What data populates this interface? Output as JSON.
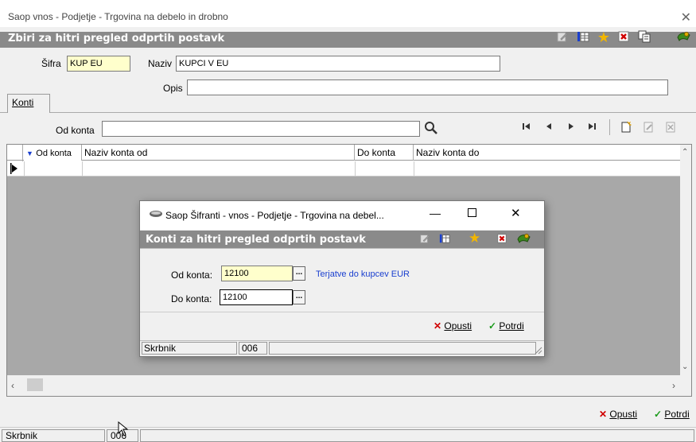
{
  "window": {
    "title": "Saop vnos - Podjetje - Trgovina na debelo in drobno",
    "close_glyph": "✕"
  },
  "header": {
    "title": "Zbiri za hitri pregled odprtih postavk",
    "toolbar_icons": [
      "edit-icon",
      "grid-icon",
      "star-icon",
      "delete-icon",
      "copy-icon",
      "exit-icon"
    ]
  },
  "form": {
    "sifra_label": "Šifra",
    "sifra_value": "KUP EU",
    "naziv_label": "Naziv",
    "naziv_value": "KUPCI V EU",
    "opis_label": "Opis",
    "opis_value": ""
  },
  "tabs": [
    {
      "label": "Konti"
    }
  ],
  "filter": {
    "label": "Od konta",
    "value": ""
  },
  "grid": {
    "columns": [
      "Od konta",
      "Naziv konta od",
      "Do konta",
      "Naziv konta do"
    ]
  },
  "bottom_buttons": {
    "cancel": "Opusti",
    "confirm": "Potrdi"
  },
  "status": {
    "user": "Skrbnik",
    "code": "006"
  },
  "dialog": {
    "window_title": "Saop Šifranti - vnos - Podjetje - Trgovina na debel...",
    "header_title": "Konti za hitri pregled odprtih postavk",
    "od_konta_label": "Od konta:",
    "od_konta_value": "12100",
    "od_konta_desc": "Terjatve do kupcev EUR",
    "do_konta_label": "Do konta:",
    "do_konta_value": "12100",
    "cancel": "Opusti",
    "confirm": "Potrdi",
    "status_user": "Skrbnik",
    "status_code": "006"
  },
  "colors": {
    "header_bg": "#8a8a8a",
    "link_blue": "#1a3fcf",
    "input_yellow": "#ffffcc"
  }
}
